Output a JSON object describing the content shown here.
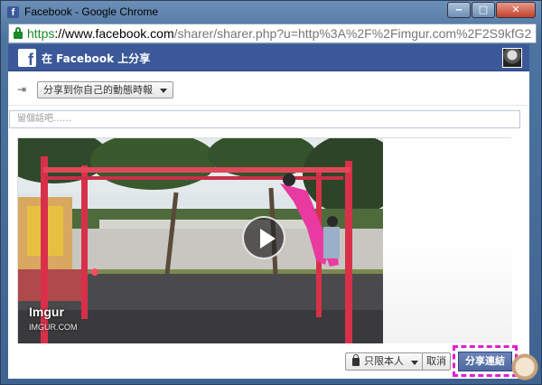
{
  "window": {
    "title": "Facebook - Google Chrome",
    "buttons": {
      "minimize": "‒",
      "maximize": "□",
      "close": "✕"
    }
  },
  "address_bar": {
    "scheme": "https",
    "host": "://www.facebook.com",
    "path": "/sharer/sharer.php?u=http%3A%2F%2Fimgur.com%2F2S9kfG2"
  },
  "header": {
    "logo": "f",
    "title": "在 Facebook 上分享"
  },
  "share_target": {
    "label": "分享到你自己的動態時報"
  },
  "comment": {
    "placeholder": "留個話吧……"
  },
  "preview": {
    "site_title": "Imgur",
    "site_domain": "IMGUR.COM"
  },
  "footer": {
    "audience": "只限本人",
    "cancel": "取消",
    "share": "分享連結"
  },
  "colors": {
    "facebook_blue": "#3b5998",
    "share_button": "#5b74a8",
    "highlight": "#e020d0",
    "https_green": "#1a8a2a"
  }
}
